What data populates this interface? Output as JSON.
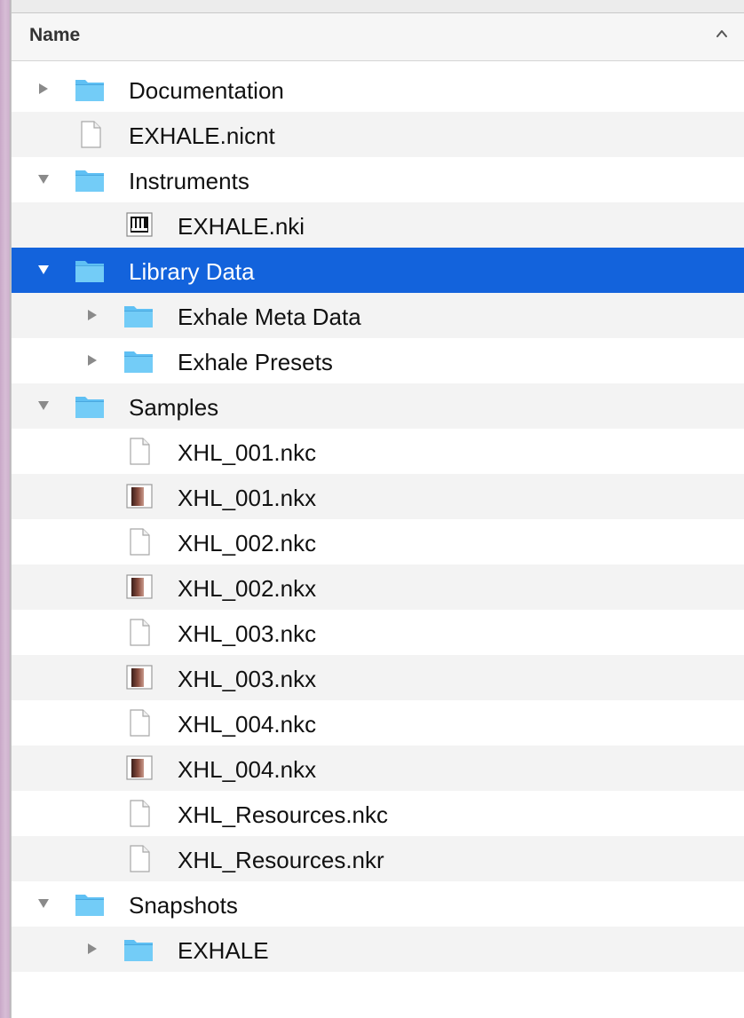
{
  "header": {
    "name": "Name"
  },
  "rows": [
    {
      "label": "Documentation",
      "kind": "folder",
      "level": 0,
      "disclosure": "collapsed"
    },
    {
      "label": "EXHALE.nicnt",
      "kind": "file",
      "level": 0,
      "disclosure": "none"
    },
    {
      "label": "Instruments",
      "kind": "folder",
      "level": 0,
      "disclosure": "expanded"
    },
    {
      "label": "EXHALE.nki",
      "kind": "instrument",
      "level": 1,
      "disclosure": "none"
    },
    {
      "label": "Library Data",
      "kind": "folder",
      "level": 0,
      "disclosure": "expanded",
      "selected": true
    },
    {
      "label": "Exhale Meta Data",
      "kind": "folder",
      "level": 1,
      "disclosure": "collapsed"
    },
    {
      "label": "Exhale Presets",
      "kind": "folder",
      "level": 1,
      "disclosure": "collapsed"
    },
    {
      "label": "Samples",
      "kind": "folder",
      "level": 0,
      "disclosure": "expanded"
    },
    {
      "label": "XHL_001.nkc",
      "kind": "file",
      "level": 1,
      "disclosure": "none"
    },
    {
      "label": "XHL_001.nkx",
      "kind": "sample",
      "level": 1,
      "disclosure": "none"
    },
    {
      "label": "XHL_002.nkc",
      "kind": "file",
      "level": 1,
      "disclosure": "none"
    },
    {
      "label": "XHL_002.nkx",
      "kind": "sample",
      "level": 1,
      "disclosure": "none"
    },
    {
      "label": "XHL_003.nkc",
      "kind": "file",
      "level": 1,
      "disclosure": "none"
    },
    {
      "label": "XHL_003.nkx",
      "kind": "sample",
      "level": 1,
      "disclosure": "none"
    },
    {
      "label": "XHL_004.nkc",
      "kind": "file",
      "level": 1,
      "disclosure": "none"
    },
    {
      "label": "XHL_004.nkx",
      "kind": "sample",
      "level": 1,
      "disclosure": "none"
    },
    {
      "label": "XHL_Resources.nkc",
      "kind": "file",
      "level": 1,
      "disclosure": "none"
    },
    {
      "label": "XHL_Resources.nkr",
      "kind": "file",
      "level": 1,
      "disclosure": "none"
    },
    {
      "label": "Snapshots",
      "kind": "folder",
      "level": 0,
      "disclosure": "expanded"
    },
    {
      "label": "EXHALE",
      "kind": "folder",
      "level": 1,
      "disclosure": "collapsed"
    }
  ],
  "colors": {
    "selection": "#1363dc",
    "folder": "#5fc0f4",
    "alt_row": "#f3f3f3"
  },
  "icons": {
    "folder": "folder-icon",
    "file": "document-icon",
    "instrument": "instrument-icon",
    "sample": "sample-file-icon",
    "collapsed": "disclosure-right-icon",
    "expanded": "disclosure-down-icon",
    "sort": "sort-ascending-icon"
  }
}
